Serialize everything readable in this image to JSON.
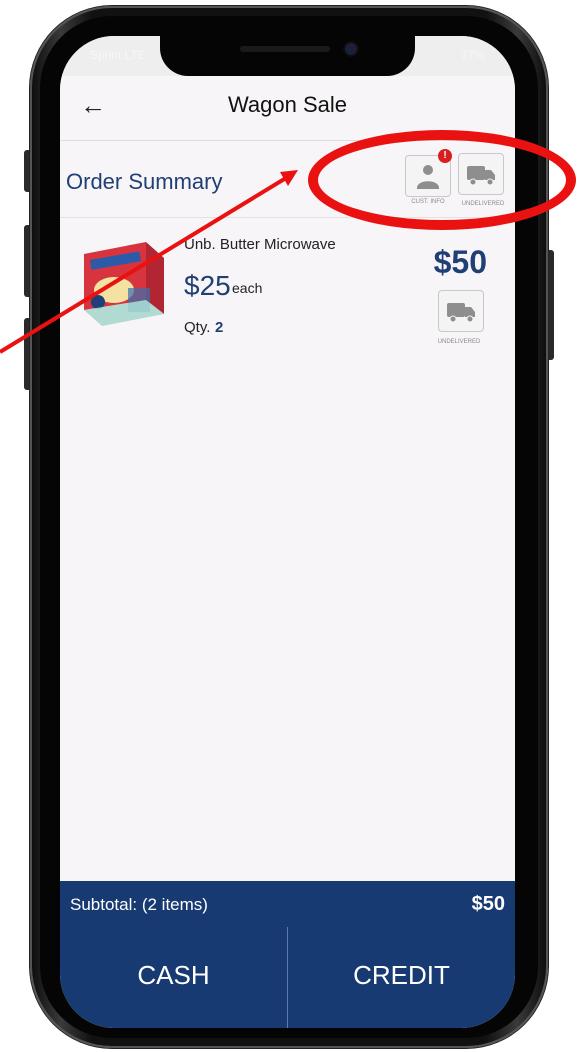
{
  "status_bar": {
    "carrier": "Sprint  LTE",
    "battery": "77%"
  },
  "header": {
    "title": "Wagon Sale",
    "back_icon": "arrow-left-icon"
  },
  "order_summary": {
    "title": "Order Summary",
    "cust_info_caption": "CUST. INFO",
    "cust_info_alert": "!",
    "delivery_caption": "UNDELIVERED"
  },
  "items": [
    {
      "name": "Unb. Butter Microwave",
      "unit_price": "$25",
      "unit_suffix": "each",
      "qty_label": "Qty.",
      "qty": "2",
      "line_total": "$50",
      "delivery_caption": "UNDELIVERED"
    }
  ],
  "footer": {
    "subtotal_label": "Subtotal: (2 items)",
    "subtotal_value": "$50",
    "cash_label": "CASH",
    "credit_label": "CREDIT"
  },
  "colors": {
    "brand_navy": "#183a72",
    "accent_blue": "#1f3f75",
    "annotation_red": "#ea1111",
    "alert_red": "#d71f1f"
  }
}
